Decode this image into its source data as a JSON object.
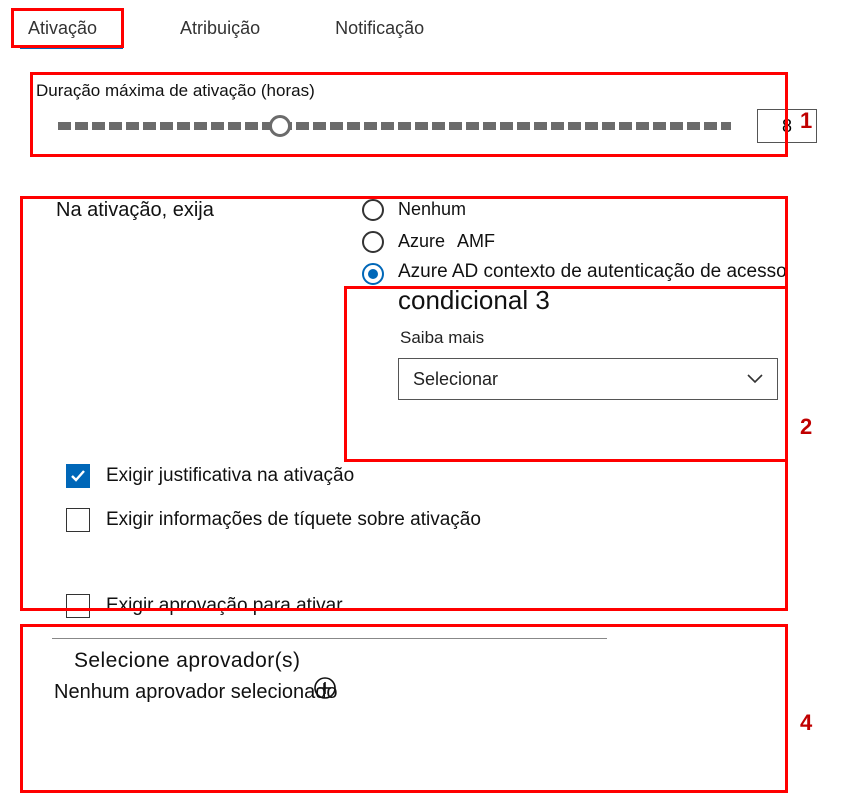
{
  "tabs": {
    "activation": "Ativação",
    "assignment": "Atribuição",
    "notification": "Notificação"
  },
  "duration": {
    "label": "Duração máxima de ativação (horas)",
    "value": "8",
    "thumb_percent": 33
  },
  "activation": {
    "left_label": "Na ativação, exija",
    "radios": {
      "none": "Nenhum",
      "amf": "Azure   AMF",
      "aad_title1": "Azure AD contexto de autenticação de acesso",
      "aad_title2": "condicional 3",
      "learn_more": "Saiba mais"
    },
    "select_placeholder": "Selecionar"
  },
  "checkboxes": {
    "justification": "Exigir justificativa na ativação",
    "ticket": "Exigir informações de tíquete sobre ativação",
    "approval": "Exigir aprovação para ativar"
  },
  "approvers": {
    "title": "Selecione aprovador(s)",
    "none": "Nenhum aprovador selecionado"
  },
  "annotations": {
    "n1": "1",
    "n2": "2",
    "n4": "4"
  }
}
